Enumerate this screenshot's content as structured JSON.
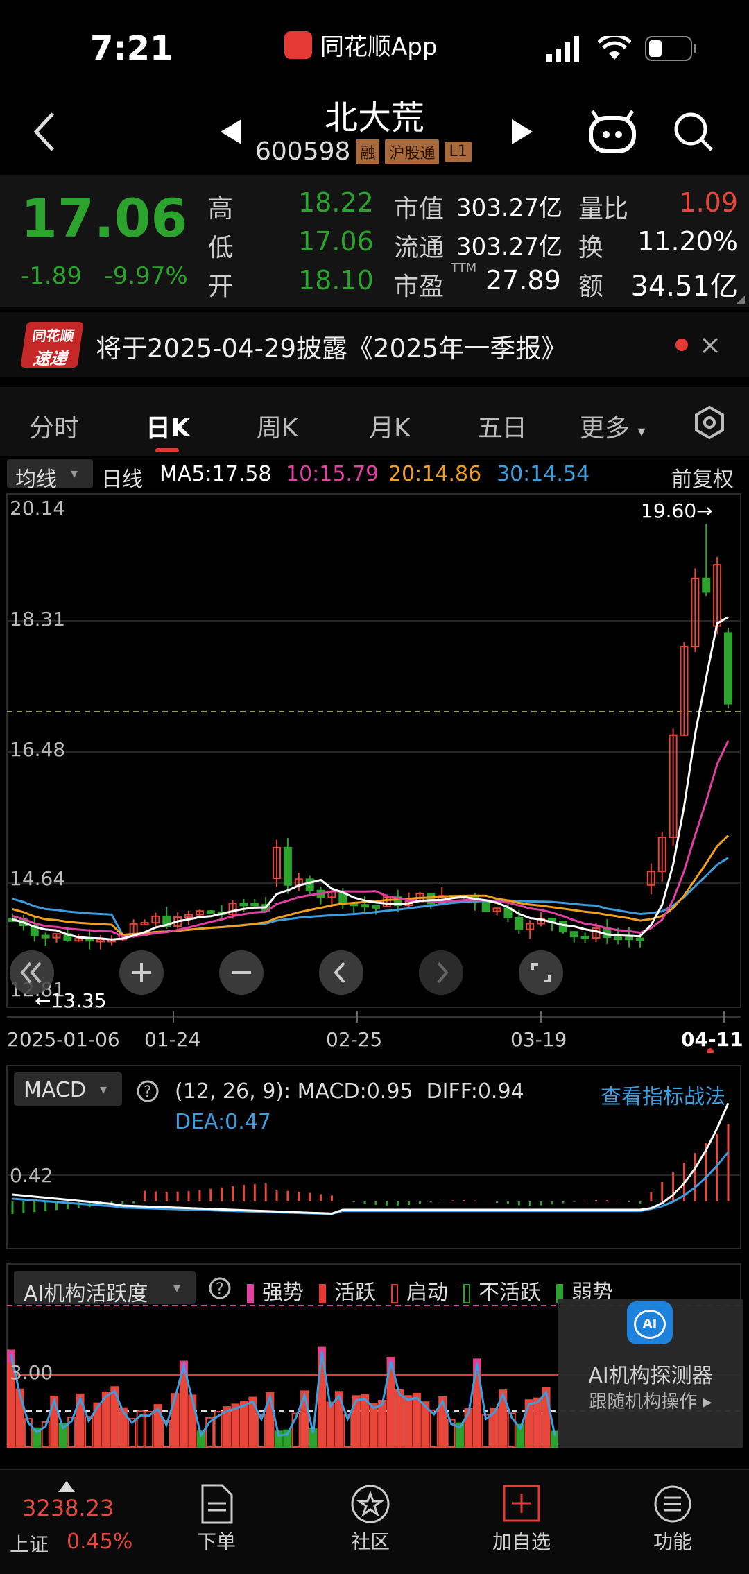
{
  "status": {
    "time": "7:21",
    "app": "同花顺App"
  },
  "stock": {
    "name": "北大荒",
    "code": "600598",
    "tags": [
      "融",
      "沪股通",
      "L1"
    ],
    "price": "17.06",
    "change": "-1.89",
    "change_pct": "-9.97%",
    "high_l": "高",
    "high": "18.22",
    "low_l": "低",
    "low": "17.06",
    "open_l": "开",
    "open": "18.10",
    "mcap_l": "市值",
    "mcap": "303.27亿",
    "float_l": "流通",
    "float": "303.27亿",
    "pe_l": "市盈",
    "pe_sup": "TTM",
    "pe": "27.89",
    "vr_l": "量比",
    "vr": "1.09",
    "turn_l": "换",
    "turn": "11.20%",
    "amt_l": "额",
    "amt": "34.51亿"
  },
  "banner": {
    "logo1": "同花顺",
    "logo2": "速递",
    "text": "将于2025-04-29披露《2025年一季报》"
  },
  "tabs": [
    "分时",
    "日K",
    "周K",
    "月K",
    "五日",
    "更多"
  ],
  "ma_bar": {
    "dropdown": "均线",
    "type": "日线",
    "ma5": "MA5:17.58",
    "ma10": "10:15.79",
    "ma20": "20:14.86",
    "ma30": "30:14.54",
    "adjust": "前复权"
  },
  "kchart": {
    "y_labels": [
      "20.14",
      "18.31",
      "16.48",
      "14.64",
      "12.81"
    ],
    "max_label": "19.60→",
    "min_label": "←13.35",
    "x_labels": [
      "2025-01-06",
      "01-24",
      "02-25",
      "03-19",
      "04-11"
    ]
  },
  "macd": {
    "dropdown": "MACD",
    "params": "(12, 26, 9):",
    "macd": "MACD:0.95",
    "diff": "DIFF:0.94",
    "dea": "DEA:0.47",
    "link": "查看指标战法",
    "y_label": "0.42"
  },
  "ai": {
    "dropdown": "AI机构活跃度",
    "legend": [
      "强势",
      "活跃",
      "启动",
      "不活跃",
      "弱势"
    ],
    "y_label": "3.00",
    "panel_title": "AI机构探测器",
    "panel_sub": "跟随机构操作 ▸",
    "panel_icon": "AI"
  },
  "bottom": {
    "index_value": "3238.23",
    "index_name": "上证",
    "index_pct": "0.45%",
    "nav": [
      "下单",
      "社区",
      "加自选",
      "功能"
    ]
  },
  "colors": {
    "up": "#e8463a",
    "down": "#2ca32c",
    "ma5": "#ffffff",
    "ma10": "#e040a0",
    "ma20": "#f0a020",
    "ma30": "#3a9ee0"
  }
}
